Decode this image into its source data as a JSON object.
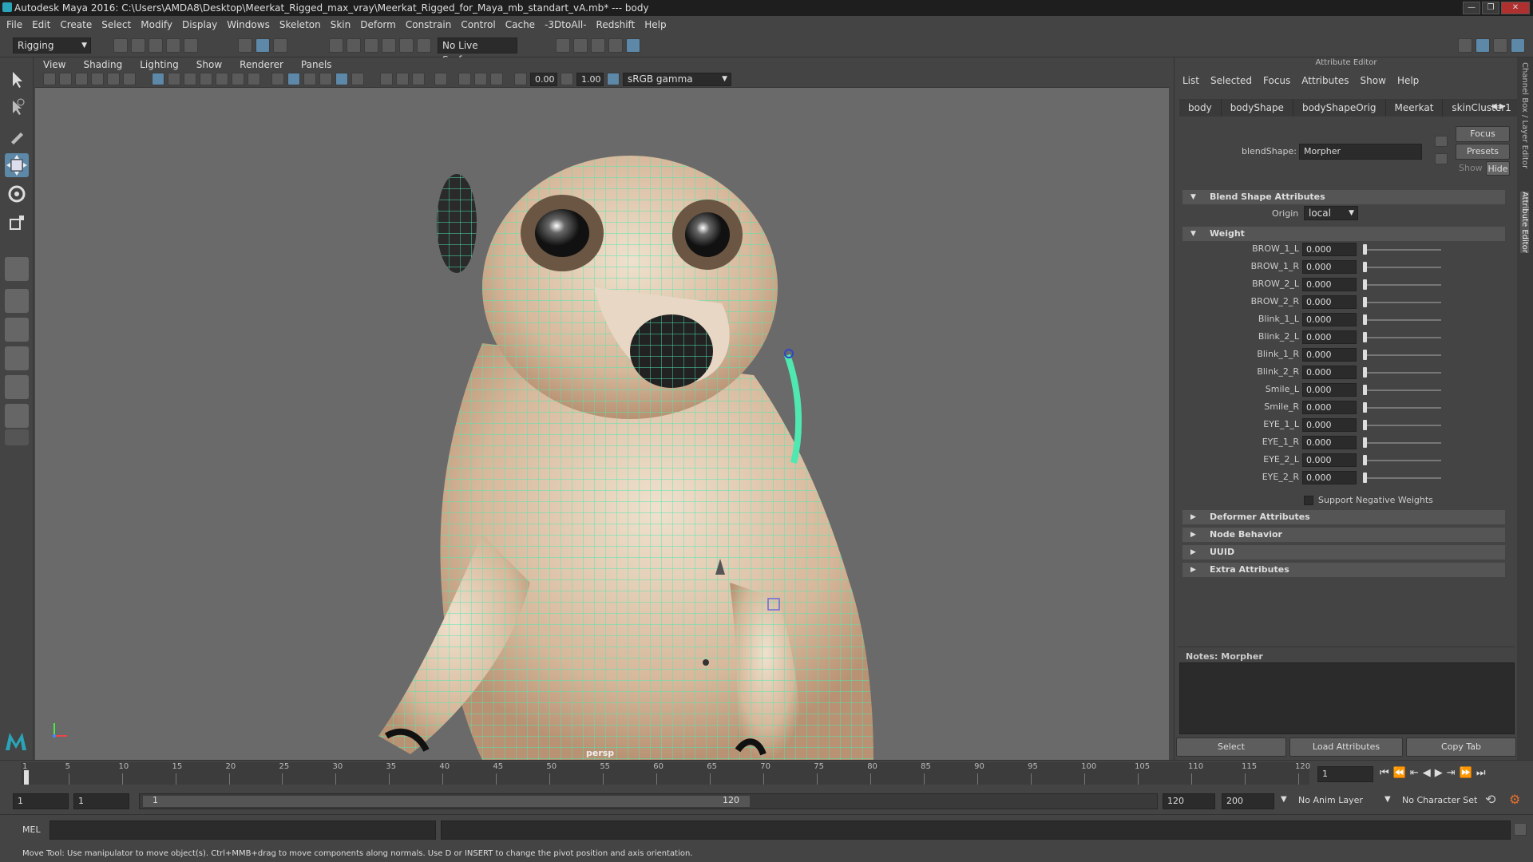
{
  "window": {
    "title": "Autodesk Maya 2016: C:\\Users\\AMDA8\\Desktop\\Meerkat_Rigged_max_vray\\Meerkat_Rigged_for_Maya_mb_standart_vA.mb*   ---   body",
    "buttons": [
      "—",
      "❐",
      "✕"
    ]
  },
  "menubar": [
    "File",
    "Edit",
    "Create",
    "Select",
    "Modify",
    "Display",
    "Windows",
    "Skeleton",
    "Skin",
    "Deform",
    "Constrain",
    "Control",
    "Cache",
    "-3DtoAll-",
    "Redshift",
    "Help"
  ],
  "shelf": {
    "mode": "Rigging",
    "live_surface": "No Live Surface"
  },
  "viewport": {
    "menu": [
      "View",
      "Shading",
      "Lighting",
      "Show",
      "Renderer",
      "Panels"
    ],
    "exposure": "0.00",
    "gamma": "1.00",
    "color_space": "sRGB gamma",
    "camera_label": "persp"
  },
  "attribute_editor": {
    "title": "Attribute Editor",
    "menu": [
      "List",
      "Selected",
      "Focus",
      "Attributes",
      "Show",
      "Help"
    ],
    "tabs": [
      "body",
      "bodyShape",
      "bodyShapeOrig",
      "Meerkat",
      "skinCluster1"
    ],
    "node_label": "blendShape:",
    "node_value": "Morpher",
    "focus_btn": "Focus",
    "presets_btn": "Presets",
    "show_label": "Show",
    "hide_btn": "Hide",
    "section_blend": "Blend Shape Attributes",
    "origin_label": "Origin",
    "origin_value": "local",
    "section_weight": "Weight",
    "weights": [
      {
        "name": "BROW_1_L",
        "value": "0.000"
      },
      {
        "name": "BROW_1_R",
        "value": "0.000"
      },
      {
        "name": "BROW_2_L",
        "value": "0.000"
      },
      {
        "name": "BROW_2_R",
        "value": "0.000"
      },
      {
        "name": "Blink_1_L",
        "value": "0.000"
      },
      {
        "name": "Blink_2_L",
        "value": "0.000"
      },
      {
        "name": "Blink_1_R",
        "value": "0.000"
      },
      {
        "name": "Blink_2_R",
        "value": "0.000"
      },
      {
        "name": "Smile_L",
        "value": "0.000"
      },
      {
        "name": "Smile_R",
        "value": "0.000"
      },
      {
        "name": "EYE_1_L",
        "value": "0.000"
      },
      {
        "name": "EYE_1_R",
        "value": "0.000"
      },
      {
        "name": "EYE_2_L",
        "value": "0.000"
      },
      {
        "name": "EYE_2_R",
        "value": "0.000"
      }
    ],
    "support_negative": "Support Negative Weights",
    "collapsed_sections": [
      "Deformer Attributes",
      "Node Behavior",
      "UUID",
      "Extra Attributes"
    ],
    "notes_label": "Notes:  Morpher",
    "bottom_buttons": [
      "Select",
      "Load Attributes",
      "Copy Tab"
    ],
    "side_tabs": [
      "Channel Box / Layer Editor",
      "Attribute Editor"
    ]
  },
  "timeline": {
    "ticks": [
      "1",
      "5",
      "10",
      "15",
      "20",
      "25",
      "30",
      "35",
      "40",
      "45",
      "50",
      "55",
      "60",
      "65",
      "70",
      "75",
      "80",
      "85",
      "90",
      "95",
      "100",
      "105",
      "110",
      "115",
      "120"
    ],
    "current_frame": "1"
  },
  "range": {
    "start": "1",
    "playback_start": "1",
    "slider_start": "1",
    "slider_end": "120",
    "playback_end": "120",
    "end": "200",
    "anim_layer": "No Anim Layer",
    "character_set": "No Character Set"
  },
  "command_line": {
    "label": "MEL"
  },
  "help_line": "Move Tool: Use manipulator to move object(s). Ctrl+MMB+drag to move components along normals. Use D or INSERT to change the pivot position and axis orientation."
}
